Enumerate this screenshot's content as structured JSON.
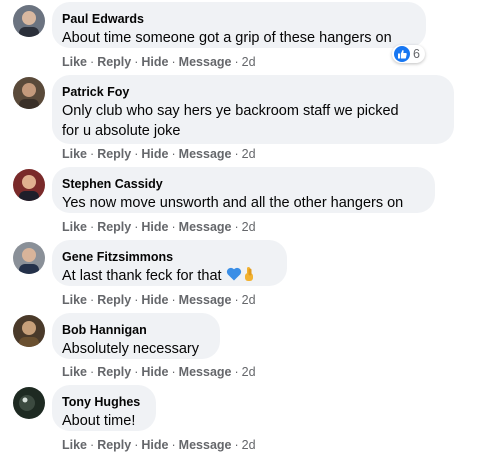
{
  "comments": [
    {
      "author": "Paul Edwards",
      "text": "About time someone got a grip of these hangers on",
      "actions": {
        "like": "Like",
        "reply": "Reply",
        "hide": "Hide",
        "message": "Message",
        "time": "2d"
      },
      "reaction_count": "6",
      "reaction_icon": "thumbs-up-icon"
    },
    {
      "author": "Patrick Foy",
      "text_lines": [
        "Only club who say hers ye backroom staff we picked",
        "for u absolute joke"
      ],
      "actions": {
        "like": "Like",
        "reply": "Reply",
        "hide": "Hide",
        "message": "Message",
        "time": "2d"
      }
    },
    {
      "author": "Stephen Cassidy",
      "text": "Yes now move unsworth and all the other hangers on",
      "actions": {
        "like": "Like",
        "reply": "Reply",
        "hide": "Hide",
        "message": "Message",
        "time": "2d"
      }
    },
    {
      "author": "Gene Fitzsimmons",
      "text": "At last thank feck for that",
      "emojis": [
        "blue-heart-icon",
        "crossed-fingers-icon"
      ],
      "actions": {
        "like": "Like",
        "reply": "Reply",
        "hide": "Hide",
        "message": "Message",
        "time": "2d"
      }
    },
    {
      "author": "Bob Hannigan",
      "text": "Absolutely necessary",
      "actions": {
        "like": "Like",
        "reply": "Reply",
        "hide": "Hide",
        "message": "Message",
        "time": "2d"
      }
    },
    {
      "author": "Tony Hughes",
      "text": "About time!",
      "actions": {
        "like": "Like",
        "reply": "Reply",
        "hide": "Hide",
        "message": "Message",
        "time": "2d"
      }
    }
  ],
  "colors": {
    "bubble": "#f0f2f5",
    "secondary_text": "#65676b",
    "like_blue": "#1877f2"
  }
}
